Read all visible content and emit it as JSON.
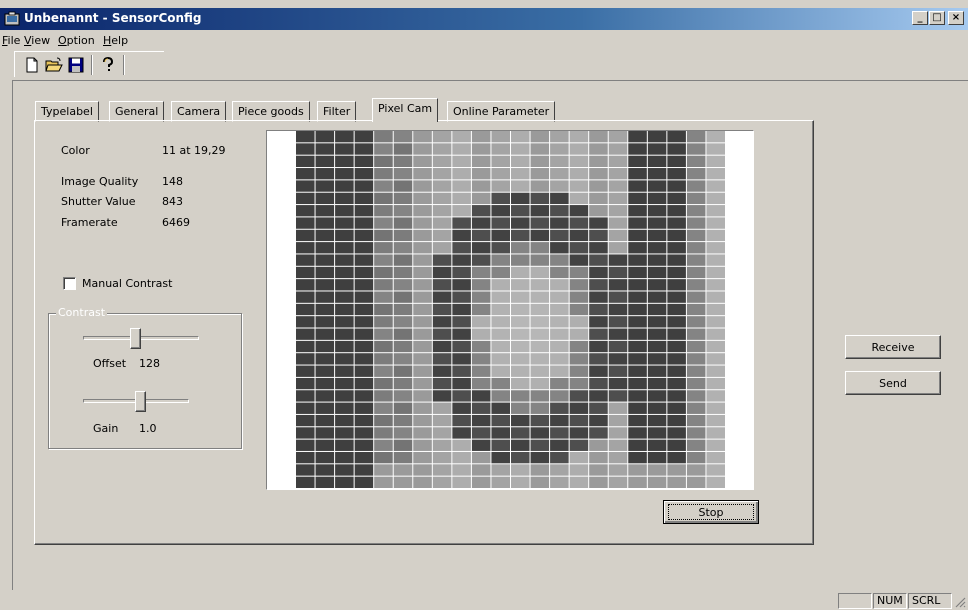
{
  "window": {
    "title": "Unbenannt - SensorConfig",
    "min_glyph": "_",
    "max_glyph": "□",
    "close_glyph": "×"
  },
  "menu": {
    "file": {
      "accel": "F",
      "rest": "ile"
    },
    "view": {
      "accel": "V",
      "rest": "iew"
    },
    "option": {
      "accel": "O",
      "rest": "ption"
    },
    "help": {
      "accel": "H",
      "rest": "elp"
    }
  },
  "toolbar": {
    "icons": [
      "new-file-icon",
      "open-folder-icon",
      "save-disk-icon",
      "help-question-icon"
    ]
  },
  "tabs": [
    {
      "label": "Typelabel",
      "active": false
    },
    {
      "label": "General",
      "active": false
    },
    {
      "label": "Camera",
      "active": false
    },
    {
      "label": "Piece goods",
      "active": false
    },
    {
      "label": "Filter",
      "active": false
    },
    {
      "label": "Pixel Cam",
      "active": true
    },
    {
      "label": "Online Parameter",
      "active": false
    }
  ],
  "info": {
    "color_label": "Color",
    "color_value": "11 at 19,29",
    "quality_label": "Image Quality",
    "quality_value": "148",
    "shutter_label": "Shutter Value",
    "shutter_value": "843",
    "framerate_label": "Framerate",
    "framerate_value": "6469"
  },
  "manual_contrast": {
    "label": "Manual Contrast",
    "checked": false
  },
  "contrast": {
    "group_label": "Contrast",
    "offset_label": "Offset",
    "offset_value": "128",
    "offset_fraction": 0.45,
    "gain_label": "Gain",
    "gain_value": "1.0",
    "gain_fraction": 0.55
  },
  "buttons": {
    "stop": "Stop",
    "receive": "Receive",
    "send": "Send"
  },
  "pixel_image": {
    "cols": 22,
    "rows": 29,
    "colors": {
      "darkest": "#303030",
      "lightest": "#c8c8c8"
    }
  },
  "statusbar": {
    "num": "NUM",
    "scrl": "SCRL"
  }
}
